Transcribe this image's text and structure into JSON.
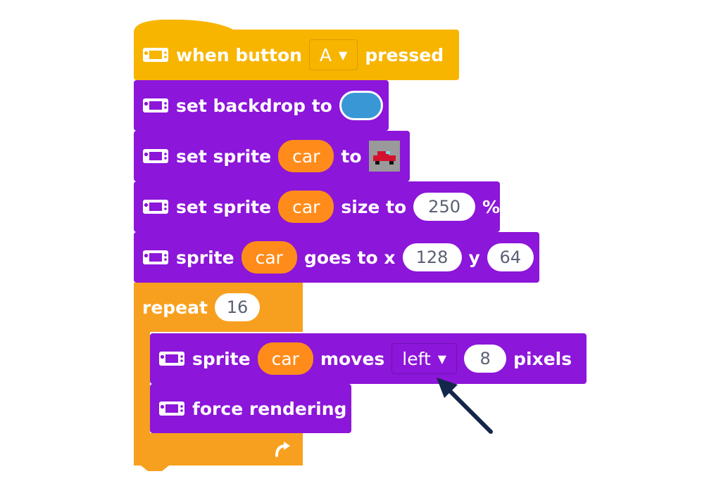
{
  "hat_block": {
    "label1": "when button",
    "button_value": "A",
    "label2": "pressed"
  },
  "backdrop_block": {
    "label": "set backdrop to",
    "color": "#3a97d6"
  },
  "set_sprite_image_block": {
    "label1": "set sprite",
    "sprite": "car",
    "label2": "to"
  },
  "set_size_block": {
    "label1": "set sprite",
    "sprite": "car",
    "label2": "size to",
    "value": "250",
    "unit": "%"
  },
  "goes_to_block": {
    "label1": "sprite",
    "sprite": "car",
    "label2": "goes to x",
    "x": "128",
    "label3": "y",
    "y": "64"
  },
  "repeat_block": {
    "label": "repeat",
    "count": "16"
  },
  "moves_block": {
    "label1": "sprite",
    "sprite": "car",
    "label2": "moves",
    "direction": "left",
    "amount": "8",
    "label3": "pixels"
  },
  "force_block": {
    "label": "force rendering"
  },
  "colors": {
    "event": "#f7b500",
    "sprites": "#8c16d9",
    "loops": "#f7a01f",
    "variable": "#ff8c1a",
    "arrow": "#14264a"
  },
  "icons": [
    "gamepad-icon",
    "caret-down-icon",
    "loop-arrow-icon",
    "car-sprite-icon",
    "pointer-arrow-icon"
  ]
}
